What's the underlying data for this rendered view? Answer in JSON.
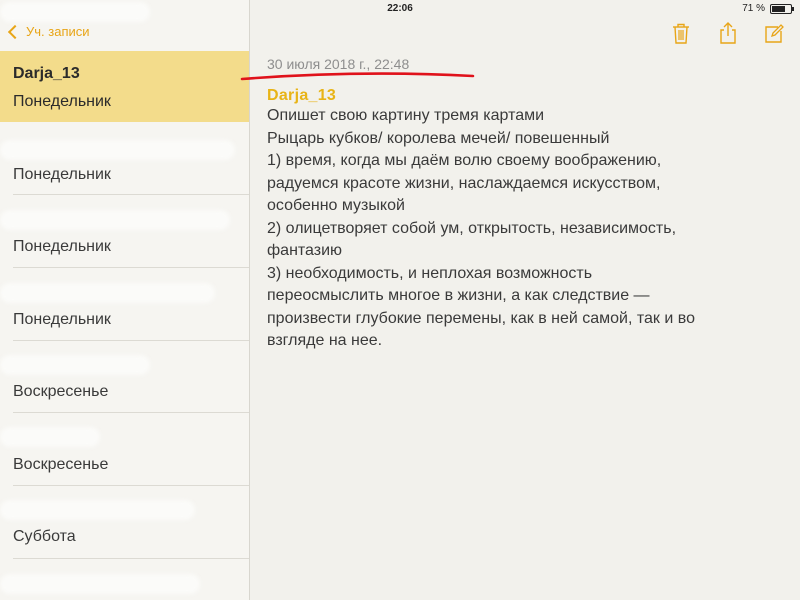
{
  "status_bar": {
    "device": "iPad",
    "time": "22:06",
    "battery": "71 %",
    "battery_level": 0.71
  },
  "sidebar": {
    "back_label": "Уч. записи",
    "selected_note": {
      "title": "Darja_13",
      "subtitle": "Понедельник"
    },
    "notes": [
      {
        "day": "Понедельник"
      },
      {
        "day": "Понедельник"
      },
      {
        "day": "Понедельник"
      },
      {
        "day": "Воскресенье"
      },
      {
        "day": "Воскресенье"
      },
      {
        "day": "Суббота"
      }
    ]
  },
  "toolbar": {
    "icons": [
      "trash-icon",
      "share-icon",
      "compose-icon"
    ]
  },
  "note": {
    "date": "30 июля 2018 г., 22:48",
    "title": "Darja_13",
    "lines": [
      "Опишет свою картину тремя картами",
      "Рыцарь кубков/ королева мечей/ повешенный",
      "1) время, когда мы даём волю своему воображению,",
      "радуемся красоте жизни, наслаждаемся искусством,",
      "особенно музыкой",
      "2) олицетворяет собой ум, открытость, независимость,",
      "фантазию",
      "3) необходимость, и неплохая возможность",
      "переосмыслить многое в жизни, а как следствие —",
      "произвести глубокие перемены, как в ней самой, так и во",
      "взгляде на нее."
    ]
  },
  "colors": {
    "accent": "#e8a517",
    "selected_bg": "#f3dc8b",
    "annotation_line": "#e0121b"
  }
}
